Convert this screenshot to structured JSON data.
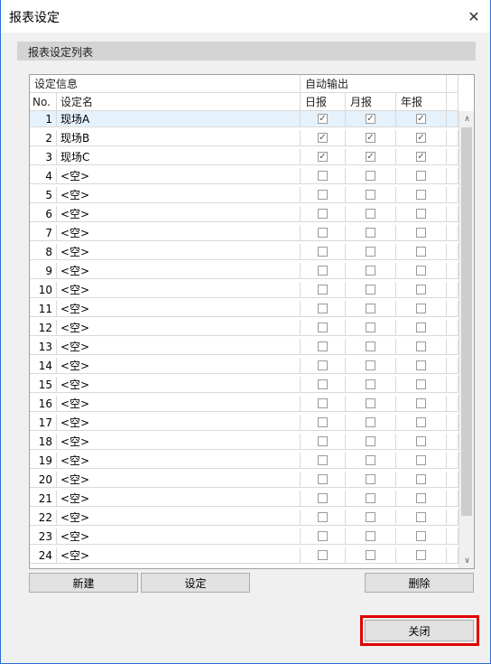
{
  "window": {
    "title": "报表设定",
    "close_glyph": "✕"
  },
  "section": {
    "title": "报表设定列表"
  },
  "table": {
    "group_headers": {
      "info": "设定信息",
      "auto_output": "自动输出"
    },
    "columns": {
      "no": "No.",
      "name": "设定名",
      "daily": "日报",
      "monthly": "月报",
      "yearly": "年报"
    },
    "rows": [
      {
        "no": "1",
        "name": "现场A",
        "daily": true,
        "monthly": true,
        "yearly": true
      },
      {
        "no": "2",
        "name": "现场B",
        "daily": true,
        "monthly": true,
        "yearly": true
      },
      {
        "no": "3",
        "name": "现场C",
        "daily": true,
        "monthly": true,
        "yearly": true
      },
      {
        "no": "4",
        "name": "<空>",
        "daily": false,
        "monthly": false,
        "yearly": false
      },
      {
        "no": "5",
        "name": "<空>",
        "daily": false,
        "monthly": false,
        "yearly": false
      },
      {
        "no": "6",
        "name": "<空>",
        "daily": false,
        "monthly": false,
        "yearly": false
      },
      {
        "no": "7",
        "name": "<空>",
        "daily": false,
        "monthly": false,
        "yearly": false
      },
      {
        "no": "8",
        "name": "<空>",
        "daily": false,
        "monthly": false,
        "yearly": false
      },
      {
        "no": "9",
        "name": "<空>",
        "daily": false,
        "monthly": false,
        "yearly": false
      },
      {
        "no": "10",
        "name": "<空>",
        "daily": false,
        "monthly": false,
        "yearly": false
      },
      {
        "no": "11",
        "name": "<空>",
        "daily": false,
        "monthly": false,
        "yearly": false
      },
      {
        "no": "12",
        "name": "<空>",
        "daily": false,
        "monthly": false,
        "yearly": false
      },
      {
        "no": "13",
        "name": "<空>",
        "daily": false,
        "monthly": false,
        "yearly": false
      },
      {
        "no": "14",
        "name": "<空>",
        "daily": false,
        "monthly": false,
        "yearly": false
      },
      {
        "no": "15",
        "name": "<空>",
        "daily": false,
        "monthly": false,
        "yearly": false
      },
      {
        "no": "16",
        "name": "<空>",
        "daily": false,
        "monthly": false,
        "yearly": false
      },
      {
        "no": "17",
        "name": "<空>",
        "daily": false,
        "monthly": false,
        "yearly": false
      },
      {
        "no": "18",
        "name": "<空>",
        "daily": false,
        "monthly": false,
        "yearly": false
      },
      {
        "no": "19",
        "name": "<空>",
        "daily": false,
        "monthly": false,
        "yearly": false
      },
      {
        "no": "20",
        "name": "<空>",
        "daily": false,
        "monthly": false,
        "yearly": false
      },
      {
        "no": "21",
        "name": "<空>",
        "daily": false,
        "monthly": false,
        "yearly": false
      },
      {
        "no": "22",
        "name": "<空>",
        "daily": false,
        "monthly": false,
        "yearly": false
      },
      {
        "no": "23",
        "name": "<空>",
        "daily": false,
        "monthly": false,
        "yearly": false
      },
      {
        "no": "24",
        "name": "<空>",
        "daily": false,
        "monthly": false,
        "yearly": false
      }
    ],
    "selected_row": 0
  },
  "scrollbar": {
    "up_glyph": "∧",
    "down_glyph": "∨"
  },
  "buttons": {
    "new": "新建",
    "set": "设定",
    "delete": "删除",
    "close": "关闭"
  },
  "colors": {
    "highlight": "#e00000",
    "selected_row": "#e5f1fb",
    "accent_border": "#2b6ed4"
  }
}
